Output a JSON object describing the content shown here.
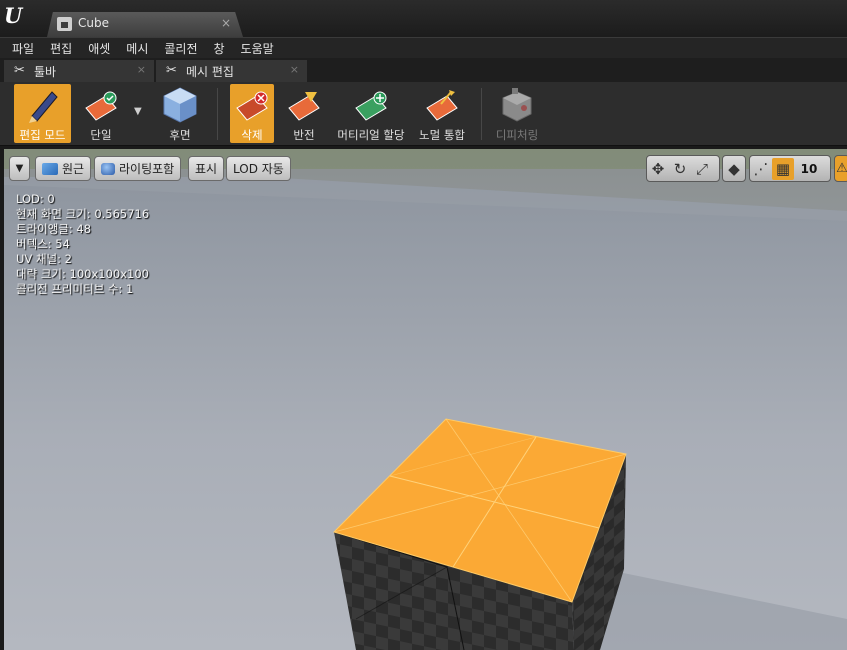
{
  "window": {
    "logo": "U",
    "tab_title": "Cube",
    "tab_close": "×"
  },
  "menu": [
    "파일",
    "편집",
    "애셋",
    "메시",
    "콜리전",
    "창",
    "도움말"
  ],
  "panel_tabs": [
    {
      "label": "툴바",
      "close": "×"
    },
    {
      "label": "메시 편집",
      "close": "×"
    }
  ],
  "toolbar": {
    "buttons": [
      {
        "label": "편집 모드",
        "icon": "pencil-icon",
        "active": true
      },
      {
        "label": "단일",
        "icon": "single-face-icon",
        "active": false
      },
      {
        "label": "후면",
        "icon": "backface-cube-icon",
        "active": false
      },
      {
        "label": "삭제",
        "icon": "delete-face-icon",
        "active": true
      },
      {
        "label": "반전",
        "icon": "flip-face-icon",
        "active": false
      },
      {
        "label": "머티리얼 할당",
        "icon": "assign-material-icon",
        "active": false
      },
      {
        "label": "노멀 통합",
        "icon": "unify-normals-icon",
        "active": false
      },
      {
        "label": "디피처링",
        "icon": "defeature-icon",
        "active": false,
        "disabled": true
      }
    ]
  },
  "viewport": {
    "buttons": {
      "perspective": "원근",
      "lighting": "라이팅포함",
      "show": "표시",
      "lod": "LOD 자동"
    },
    "stats": [
      "LOD:  0",
      "현재 화면 크기: 0.565716",
      "트라이앵글: 48",
      "버텍스: 54",
      "UV 채널:  2",
      "대략 크기: 100x100x100",
      "콜리전 프리미티브 수: 1"
    ],
    "snap_value": "10",
    "accent": "#f5a623"
  }
}
